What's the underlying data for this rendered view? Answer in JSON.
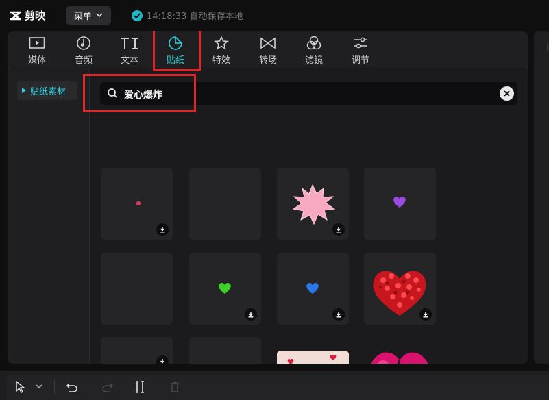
{
  "app": {
    "name": "剪映",
    "menu_label": "菜单",
    "save_status": "14:18:33 自动保存本地"
  },
  "tabs": [
    {
      "label": "媒体",
      "icon": "media-icon"
    },
    {
      "label": "音频",
      "icon": "audio-icon"
    },
    {
      "label": "文本",
      "icon": "text-icon"
    },
    {
      "label": "贴纸",
      "icon": "sticker-icon",
      "active": true
    },
    {
      "label": "特效",
      "icon": "effects-icon"
    },
    {
      "label": "转场",
      "icon": "transition-icon"
    },
    {
      "label": "滤镜",
      "icon": "filter-icon"
    },
    {
      "label": "调节",
      "icon": "adjust-icon"
    }
  ],
  "sidebar": {
    "items": [
      {
        "label": "贴纸素材",
        "active": true
      }
    ]
  },
  "search": {
    "value": "爱心爆炸"
  },
  "stickers": [
    {
      "name": "red-dot-sticker",
      "downloadable": true
    },
    {
      "name": "blank-sticker",
      "downloadable": false
    },
    {
      "name": "pink-burst-sticker",
      "downloadable": true
    },
    {
      "name": "purple-heart-sticker",
      "downloadable": false
    },
    {
      "name": "blank-sticker",
      "downloadable": false
    },
    {
      "name": "green-heart-sticker",
      "downloadable": true
    },
    {
      "name": "blue-heart-sticker",
      "downloadable": true
    },
    {
      "name": "red-heart-cluster-sticker",
      "downloadable": true
    },
    {
      "name": "blank-sticker",
      "downloadable": true
    },
    {
      "name": "gray-burst-sticker",
      "downloadable": false
    },
    {
      "name": "cartoon-scene-sticker",
      "downloadable": false
    },
    {
      "name": "broken-heart-sticker",
      "downloadable": false
    }
  ],
  "colors": {
    "accent": "#2fd1dd",
    "highlight": "#e1262a",
    "background": "#1f1f21"
  }
}
